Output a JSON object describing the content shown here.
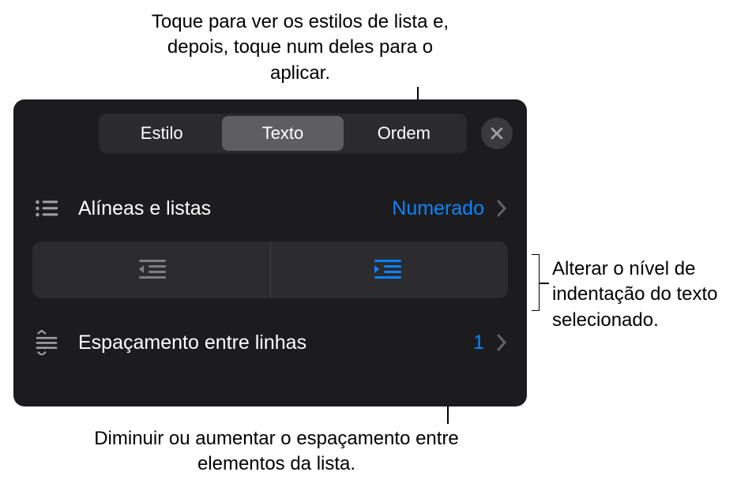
{
  "callouts": {
    "top": "Toque para ver os estilos de lista e, depois, toque num deles para o aplicar.",
    "right": "Alterar o nível de indentação do texto selecionado.",
    "bottom": "Diminuir ou aumentar o espaçamento entre elementos da lista."
  },
  "tabs": {
    "style": "Estilo",
    "text": "Texto",
    "order": "Ordem"
  },
  "rows": {
    "bullets": {
      "label": "Alíneas e listas",
      "value": "Numerado"
    },
    "lineSpacing": {
      "label": "Espaçamento entre linhas",
      "value": "1"
    }
  }
}
